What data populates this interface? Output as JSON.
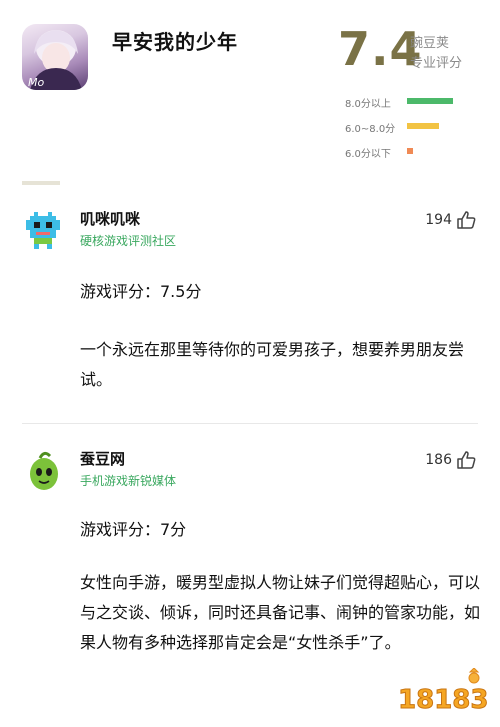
{
  "app": {
    "title": "早安我的少年",
    "icon_text": "Mo"
  },
  "rating": {
    "score": "7.4",
    "source_line1": "豌豆荚",
    "source_line2": "专业评分",
    "legend": [
      {
        "label": "8.0分以上",
        "color": "#4cb96a",
        "fill": 1.0
      },
      {
        "label": "6.0~8.0分",
        "color": "#f2c343",
        "fill": 0.57
      },
      {
        "label": "6.0分以下",
        "color": "#f08a55",
        "fill": 0.11
      }
    ]
  },
  "reviews": [
    {
      "name": "叽咪叽咪",
      "org": "硬核游戏评测社区",
      "likes": "194",
      "score": "游戏评分：7.5分",
      "text": "一个永远在那里等待你的可爱男孩子，想要养男朋友尝试。",
      "avatar_icon": "pixel-robot-icon"
    },
    {
      "name": "蚕豆网",
      "org": "手机游戏新锐媒体",
      "likes": "186",
      "score": "游戏评分：7分",
      "text": "女性向手游，暖男型虚拟人物让妹子们觉得超贴心，可以与之交谈、倾诉，同时还具备记事、闹钟的管家功能，如果人物有多种选择那肯定会是“女性杀手”了。",
      "avatar_icon": "green-bean-icon"
    }
  ],
  "watermark": {
    "text": "18183"
  }
}
